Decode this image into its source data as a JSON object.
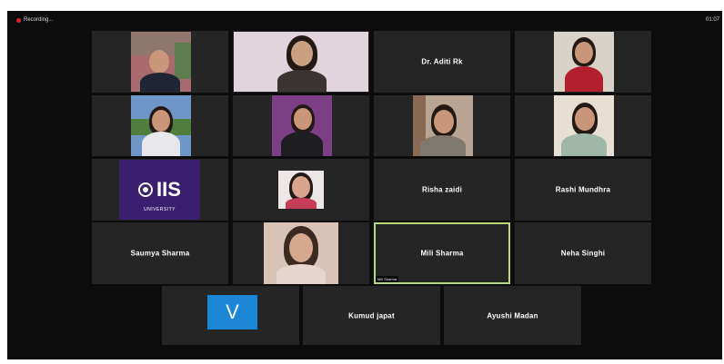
{
  "window": {
    "recording_label": "Recording...",
    "clock": "01:07"
  },
  "participants": {
    "row1": {
      "p1": {
        "kind": "video"
      },
      "p2": {
        "kind": "video"
      },
      "p3": {
        "name": "Dr. Aditi Rk"
      },
      "p4": {
        "kind": "video"
      }
    },
    "row3": {
      "logo_text": "IIS",
      "logo_sub": "UNIVERSITY",
      "p3": {
        "name": "Risha zaidi"
      },
      "p4": {
        "name": "Rashi Mundhra"
      }
    },
    "row4": {
      "p1": {
        "name": "Saumya Sharma"
      },
      "p3": {
        "name": "Mili Sharma",
        "tag": "Mili Sharma"
      },
      "p4": {
        "name": "Neha Singhi"
      }
    },
    "row5": {
      "p1": {
        "avatar_letter": "V"
      },
      "p2": {
        "name": "Kumud japat"
      },
      "p3": {
        "name": "Ayushi Madan"
      }
    }
  },
  "colors": {
    "background": "#0c0c0c",
    "tile": "#252525",
    "active_speaker_border": "#b7d97f",
    "avatar_blue": "#1c86d6",
    "logo_purple": "#3a1f6e",
    "recording_red": "#e02424"
  }
}
